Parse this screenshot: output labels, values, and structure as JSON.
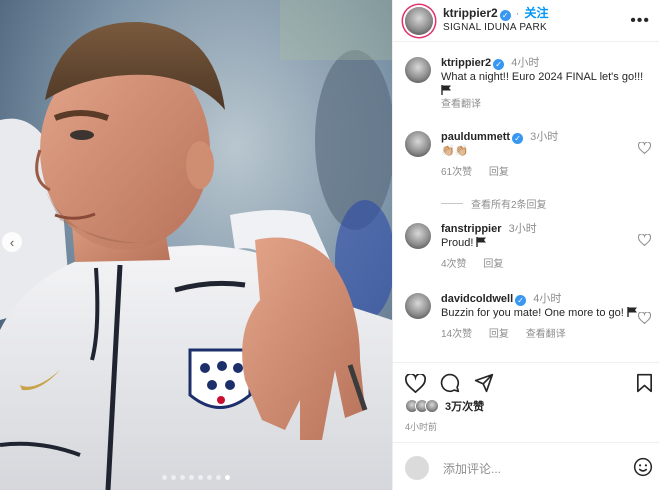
{
  "post": {
    "username": "ktrippier2",
    "follow_label": "关注",
    "location": "SIGNAL IDUNA PARK",
    "more_label": "•••"
  },
  "caption": {
    "username": "ktrippier2",
    "time": "4小时",
    "text": "What a night!! Euro 2024 FINAL let's go!!!",
    "translate_label": "查看翻译"
  },
  "comments": [
    {
      "username": "pauldummett",
      "time": "3小时",
      "text": "👏🏼👏🏼",
      "likes": "61次赞",
      "reply_label": "回复"
    },
    {
      "username": "fanstrippier",
      "time": "3小时",
      "text": "Proud!",
      "likes": "4次赞",
      "reply_label": "回复"
    },
    {
      "username": "davidcoldwell",
      "time": "4小时",
      "text": "Buzzin for you mate! One more to go!",
      "likes": "14次赞",
      "reply_label": "回复",
      "translate_label": "查看翻译"
    }
  ],
  "view_replies_label": "查看所有2条回复",
  "likes_count": "3万次赞",
  "post_time": "4小时前",
  "add_comment_placeholder": "添加评论...",
  "carousel": {
    "total": 8,
    "active": 7
  },
  "colors": {
    "accent": "#0095f6",
    "verified": "#3897f0",
    "muted": "#8e8e8e"
  },
  "icons": [
    "more-options-icon",
    "heart-icon",
    "comment-icon",
    "share-icon",
    "bookmark-icon",
    "emoji-icon",
    "chevron-left-icon",
    "flag-icon",
    "verified-icon"
  ]
}
